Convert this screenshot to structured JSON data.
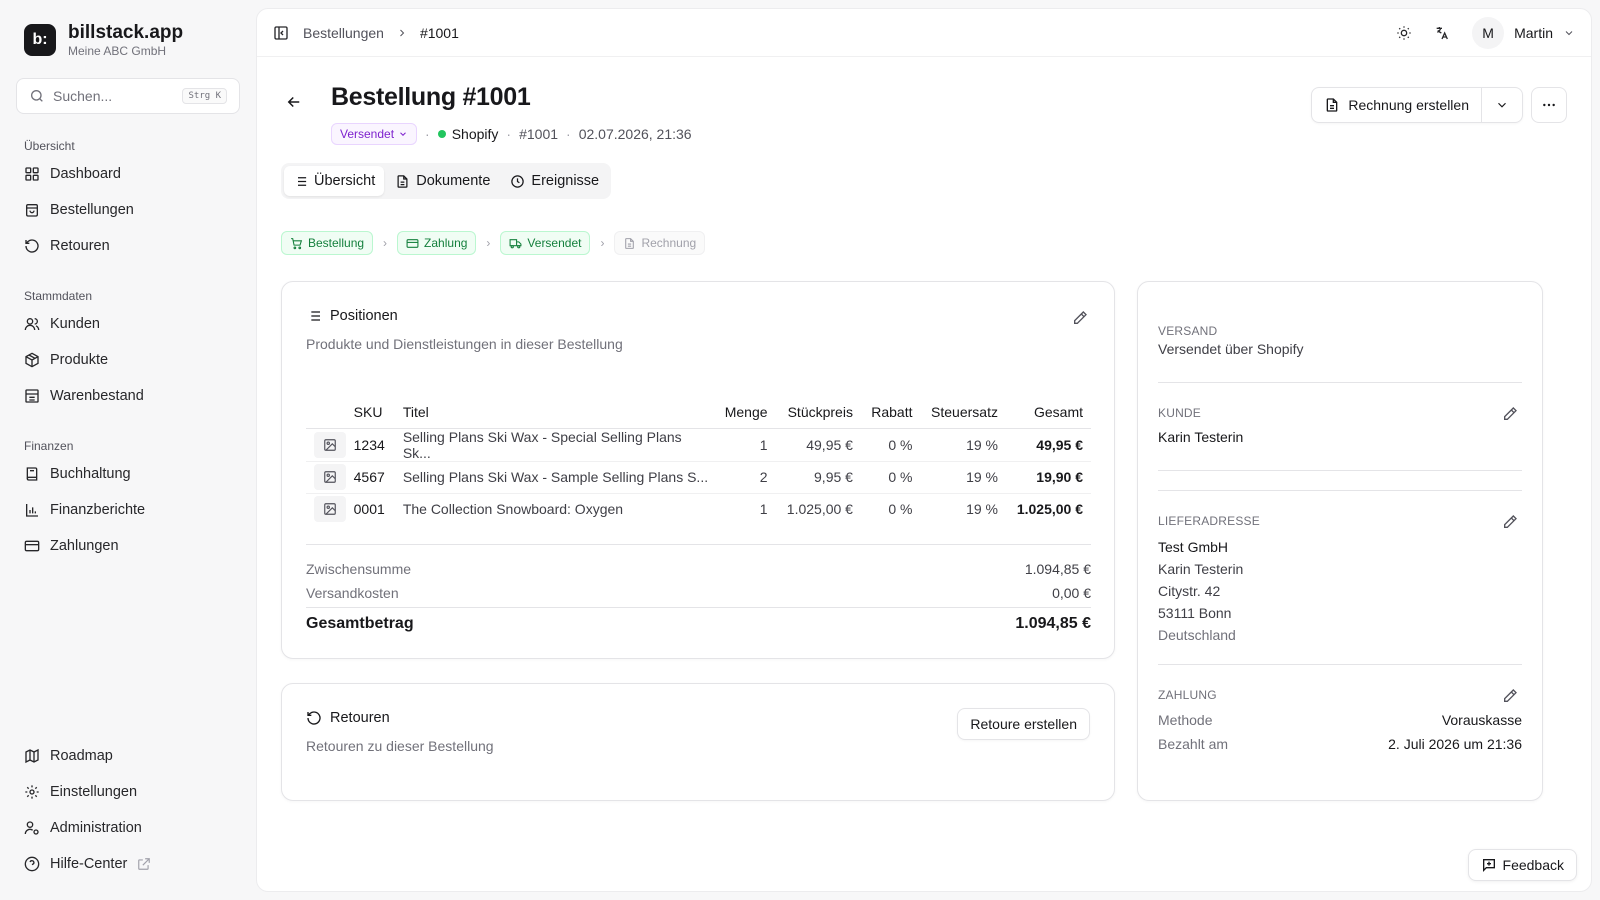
{
  "brand": {
    "logo_text": "b:",
    "name": "billstack.app",
    "company": "Meine ABC GmbH"
  },
  "search": {
    "placeholder": "Suchen...",
    "shortcut": "Strg K"
  },
  "nav": {
    "sections": [
      {
        "title": "Übersicht",
        "items": [
          {
            "label": "Dashboard",
            "icon": "grid-icon"
          },
          {
            "label": "Bestellungen",
            "icon": "bag-icon"
          },
          {
            "label": "Retouren",
            "icon": "undo-icon"
          }
        ]
      },
      {
        "title": "Stammdaten",
        "items": [
          {
            "label": "Kunden",
            "icon": "users-icon"
          },
          {
            "label": "Produkte",
            "icon": "package-icon"
          },
          {
            "label": "Warenbestand",
            "icon": "warehouse-icon"
          }
        ]
      },
      {
        "title": "Finanzen",
        "items": [
          {
            "label": "Buchhaltung",
            "icon": "book-icon"
          },
          {
            "label": "Finanzberichte",
            "icon": "bar-chart-icon"
          },
          {
            "label": "Zahlungen",
            "icon": "credit-card-icon"
          }
        ]
      }
    ],
    "bottom": [
      {
        "label": "Roadmap",
        "icon": "map-icon"
      },
      {
        "label": "Einstellungen",
        "icon": "gear-icon"
      },
      {
        "label": "Administration",
        "icon": "user-cog-icon"
      },
      {
        "label": "Hilfe-Center",
        "icon": "help-circle-icon"
      }
    ]
  },
  "topbar": {
    "breadcrumb": [
      "Bestellungen",
      "#1001"
    ],
    "user": {
      "initial": "M",
      "name": "Martin"
    }
  },
  "order": {
    "title": "Bestellung #1001",
    "status": "Versendet",
    "channel": "Shopify",
    "number": "#1001",
    "datetime": "02.07.2026, 21:36",
    "create_invoice_label": "Rechnung erstellen"
  },
  "tabs": [
    {
      "label": "Übersicht",
      "icon": "list-icon",
      "active": true
    },
    {
      "label": "Dokumente",
      "icon": "document-icon",
      "active": false
    },
    {
      "label": "Ereignisse",
      "icon": "clock-icon",
      "active": false
    }
  ],
  "pipeline": [
    {
      "label": "Bestellung",
      "state": "done",
      "icon": "cart-icon"
    },
    {
      "label": "Zahlung",
      "state": "done",
      "icon": "credit-card-icon"
    },
    {
      "label": "Versendet",
      "state": "done",
      "icon": "truck-icon"
    },
    {
      "label": "Rechnung",
      "state": "pending",
      "icon": "document-icon"
    }
  ],
  "positions": {
    "title": "Positionen",
    "description": "Produkte und Dienstleistungen in dieser Bestellung",
    "columns": [
      "SKU",
      "Titel",
      "Menge",
      "Stückpreis",
      "Rabatt",
      "Steuersatz",
      "Gesamt"
    ],
    "rows": [
      {
        "sku": "1234",
        "title": "Selling Plans Ski Wax - Special Selling Plans Sk...",
        "qty": "1",
        "unit_price": "49,95 €",
        "discount": "0 %",
        "tax": "19 %",
        "total": "49,95 €"
      },
      {
        "sku": "4567",
        "title": "Selling Plans Ski Wax - Sample Selling Plans S...",
        "qty": "2",
        "unit_price": "9,95 €",
        "discount": "0 %",
        "tax": "19 %",
        "total": "19,90 €"
      },
      {
        "sku": "0001",
        "title": "The Collection Snowboard: Oxygen",
        "qty": "1",
        "unit_price": "1.025,00 €",
        "discount": "0 %",
        "tax": "19 %",
        "total": "1.025,00 €"
      }
    ],
    "subtotal_label": "Zwischensumme",
    "subtotal": "1.094,85 €",
    "shipping_label": "Versandkosten",
    "shipping": "0,00 €",
    "total_label": "Gesamtbetrag",
    "total": "1.094,85 €"
  },
  "returns": {
    "title": "Retouren",
    "description": "Retouren zu dieser Bestellung",
    "button": "Retoure erstellen"
  },
  "side": {
    "shipping_label": "VERSAND",
    "shipping_value": "Versendet über Shopify",
    "customer_label": "KUNDE",
    "customer_value": "Karin Testerin",
    "address_label": "LIEFERADRESSE",
    "address": [
      "Test GmbH",
      "Karin Testerin",
      "Citystr. 42",
      "53111 Bonn",
      "Deutschland"
    ],
    "payment_label": "ZAHLUNG",
    "method_label": "Methode",
    "method": "Vorauskasse",
    "paid_label": "Bezahlt am",
    "paid": "2. Juli 2026 um 21:36"
  },
  "feedback_label": "Feedback"
}
